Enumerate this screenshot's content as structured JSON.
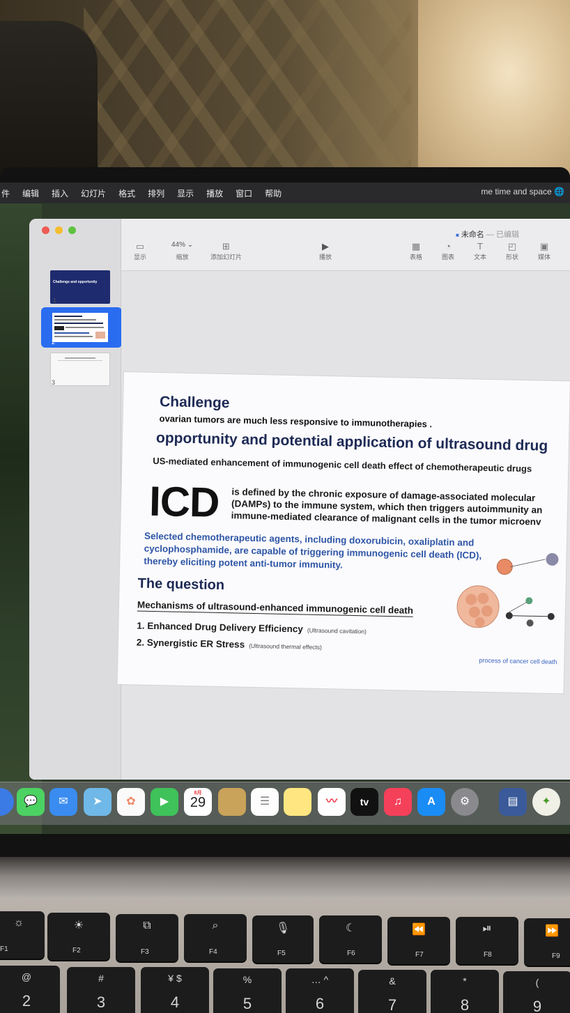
{
  "menubar": {
    "items": [
      "件",
      "编辑",
      "插入",
      "幻灯片",
      "格式",
      "排列",
      "显示",
      "播放",
      "窗口",
      "帮助"
    ],
    "right_text": "me time and space"
  },
  "window": {
    "title": "未命名",
    "status": "— 已编辑",
    "toolbar": {
      "view_label": "显示",
      "zoom_value": "44%",
      "zoom_label": "缩放",
      "add_slide_label": "添加幻灯片",
      "play_label": "播放",
      "table_label": "表格",
      "chart_label": "图表",
      "text_label": "文本",
      "shape_label": "形状",
      "media_label": "媒体"
    },
    "slides": [
      {
        "number": "1",
        "title": "Challenge and opportunity"
      },
      {
        "number": "2"
      },
      {
        "number": "3"
      }
    ]
  },
  "slide": {
    "challenge_title": "Challenge",
    "challenge_text": "ovarian tumors are much less responsive to immunotherapies .",
    "opportunity_title": "opportunity and potential application of ultrasound drug",
    "us_text": "US-mediated enhancement of immunogenic cell death effect of chemotherapeutic drugs",
    "icd": "ICD",
    "icd_def_1": "is defined by the chronic exposure of damage-associated molecular",
    "icd_def_2": "(DAMPs) to the immune system, which then triggers autoimmunity an",
    "icd_def_3": "immune-mediated clearance of malignant cells in the tumor microenv",
    "selected_text": "Selected chemotherapeutic agents, including doxorubicin, oxaliplatin and cyclophosphamide, are capable of triggering immunogenic cell death (ICD), thereby eliciting potent anti-tumor immunity.",
    "question_title": "The question",
    "mechanisms": "Mechanisms of ultrasound-enhanced immunogenic cell death",
    "item1": "1. Enhanced Drug Delivery Efficiency",
    "item1_note": "(Ultrasound cavitation)",
    "item2": "2. Synergistic ER Stress",
    "item2_note": "(Ultrasound thermal effects)",
    "diagram_caption": "process of cancer cell death"
  },
  "dock": {
    "calendar_month": "8月",
    "calendar_day": "29",
    "tv_label": "tv"
  },
  "keyboard": {
    "fkeys": [
      "F1",
      "F2",
      "F3",
      "F4",
      "F5",
      "F6",
      "F7",
      "F8",
      "F9"
    ],
    "numkeys": [
      {
        "top": "@",
        "bottom": "2"
      },
      {
        "top": "#",
        "bottom": "3"
      },
      {
        "top": "¥ $",
        "bottom": "4"
      },
      {
        "top": "%",
        "bottom": "5"
      },
      {
        "top": "… ^",
        "bottom": "6"
      },
      {
        "top": "&",
        "bottom": "7"
      },
      {
        "top": "*",
        "bottom": "8"
      },
      {
        "top": "(",
        "bottom": "9"
      }
    ]
  }
}
